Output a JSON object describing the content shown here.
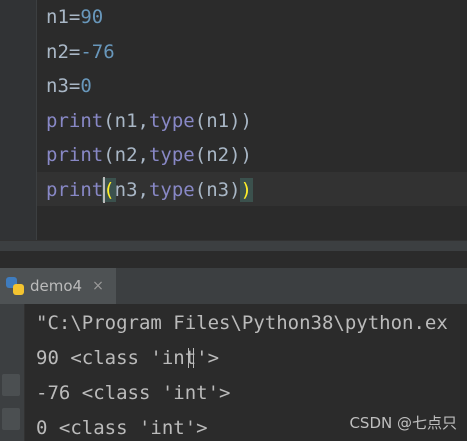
{
  "editor": {
    "lines": [
      {
        "parts": [
          [
            "n1",
            "ident"
          ],
          [
            "=",
            "op"
          ],
          [
            "90",
            "num"
          ]
        ]
      },
      {
        "parts": [
          [
            "n2",
            "ident"
          ],
          [
            "=",
            "op"
          ],
          [
            "-76",
            "num"
          ]
        ]
      },
      {
        "parts": [
          [
            "n3",
            "ident"
          ],
          [
            "=",
            "op"
          ],
          [
            "0",
            "num"
          ]
        ]
      },
      {
        "parts": [
          [
            "print",
            "builtin"
          ],
          [
            "(",
            "paren"
          ],
          [
            "n1,",
            "ident"
          ],
          [
            "type",
            "builtin"
          ],
          [
            "(",
            "paren"
          ],
          [
            "n1",
            "ident"
          ],
          [
            ")",
            "paren"
          ],
          [
            ")",
            "paren"
          ]
        ]
      },
      {
        "parts": [
          [
            "print",
            "builtin"
          ],
          [
            "(",
            "paren"
          ],
          [
            "n2,",
            "ident"
          ],
          [
            "type",
            "builtin"
          ],
          [
            "(",
            "paren"
          ],
          [
            "n2",
            "ident"
          ],
          [
            ")",
            "paren"
          ],
          [
            ")",
            "paren"
          ]
        ]
      },
      {
        "parts": [
          [
            "print",
            "builtin"
          ],
          [
            "(",
            "paren-match"
          ],
          [
            "n3,",
            "ident"
          ],
          [
            "type",
            "builtin"
          ],
          [
            "(",
            "paren"
          ],
          [
            "n3",
            "ident"
          ],
          [
            ")",
            "paren"
          ],
          [
            ")",
            "paren-match"
          ]
        ]
      }
    ],
    "current_line_index": 5
  },
  "run": {
    "tab_label": "demo4",
    "tab_close": "×",
    "tab_icon": "python-icon",
    "output_lines": [
      "\"C:\\Program Files\\Python38\\python.ex",
      "90 <class 'int'>",
      "-76 <class 'int'>",
      "0 <class 'int'>"
    ]
  },
  "watermark": "CSDN @七点只",
  "colors": {
    "background": "#2b2b2b",
    "number": "#6897bb",
    "builtin": "#8888c6",
    "text": "#a9b7c6",
    "bracket_match": "#3b514d"
  }
}
